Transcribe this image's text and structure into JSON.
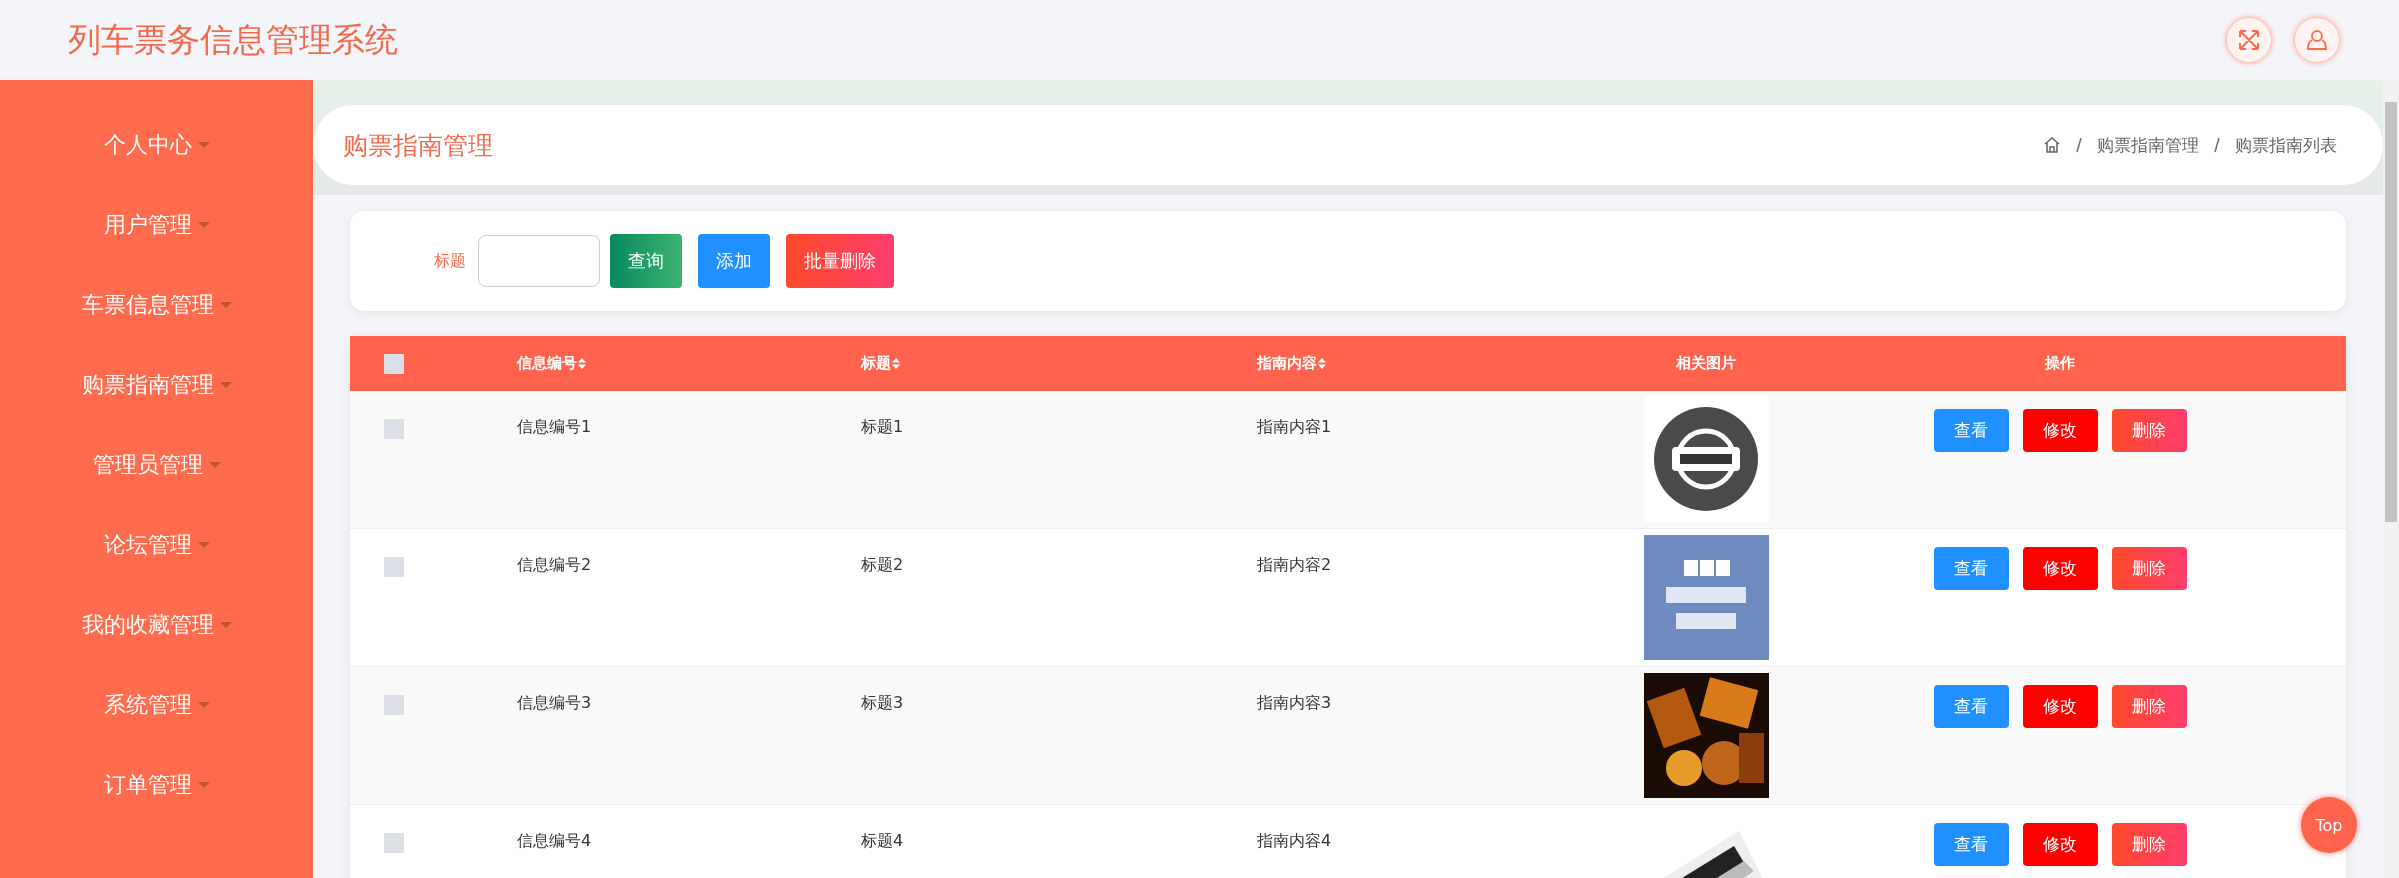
{
  "header": {
    "title": "列车票务信息管理系统"
  },
  "sidebar": {
    "items": [
      {
        "label": "个人中心"
      },
      {
        "label": "用户管理"
      },
      {
        "label": "车票信息管理"
      },
      {
        "label": "购票指南管理"
      },
      {
        "label": "管理员管理"
      },
      {
        "label": "论坛管理"
      },
      {
        "label": "我的收藏管理"
      },
      {
        "label": "系统管理"
      },
      {
        "label": "订单管理"
      }
    ]
  },
  "page": {
    "title": "购票指南管理",
    "breadcrumb": [
      "购票指南管理",
      "购票指南列表"
    ]
  },
  "search": {
    "label": "标题",
    "buttons": [
      {
        "label": "查询",
        "kind": "search"
      },
      {
        "label": "添加",
        "kind": "add"
      },
      {
        "label": "批量删除",
        "kind": "batch-delete"
      }
    ]
  },
  "table": {
    "select_all": {
      "checked": false
    },
    "columns": [
      {
        "label": "信息编号",
        "sortable": true
      },
      {
        "label": "标题",
        "sortable": true
      },
      {
        "label": "指南内容",
        "sortable": true
      },
      {
        "label": "相关图片",
        "sortable": false
      },
      {
        "label": "操作",
        "sortable": false
      }
    ],
    "rows": [
      {
        "checked": false,
        "cells": [
          "信息编号1",
          "标题1",
          "指南内容1"
        ],
        "image": {
          "kind": "picture"
        },
        "actions": [
          {
            "label": "查看",
            "kind": "view"
          },
          {
            "label": "修改",
            "kind": "edit"
          },
          {
            "label": "删除",
            "kind": "delete"
          }
        ]
      },
      {
        "checked": false,
        "cells": [
          "信息编号2",
          "标题2",
          "指南内容2"
        ],
        "image": {
          "kind": "picture"
        },
        "actions": [
          {
            "label": "查看",
            "kind": "view"
          },
          {
            "label": "修改",
            "kind": "edit"
          },
          {
            "label": "删除",
            "kind": "delete"
          }
        ]
      },
      {
        "checked": false,
        "cells": [
          "信息编号3",
          "标题3",
          "指南内容3"
        ],
        "image": {
          "kind": "picture"
        },
        "actions": [
          {
            "label": "查看",
            "kind": "view"
          },
          {
            "label": "修改",
            "kind": "edit"
          },
          {
            "label": "删除",
            "kind": "delete"
          }
        ]
      },
      {
        "checked": false,
        "cells": [
          "信息编号4",
          "标题4",
          "指南内容4"
        ],
        "image": {
          "kind": "picture"
        },
        "actions": [
          {
            "label": "查看",
            "kind": "view"
          },
          {
            "label": "修改",
            "kind": "edit"
          },
          {
            "label": "删除",
            "kind": "delete"
          }
        ]
      }
    ]
  },
  "back_to_top": {
    "label": "Top"
  }
}
